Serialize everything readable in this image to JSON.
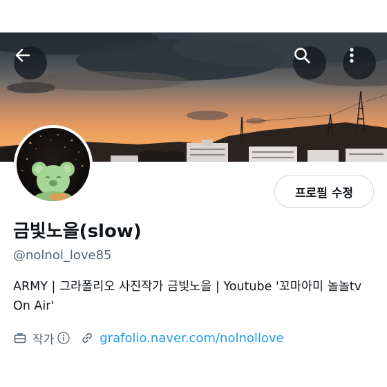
{
  "header": {
    "back_icon": "arrow-left-icon",
    "search_icon": "search-icon",
    "more_icon": "more-vertical-icon"
  },
  "profile": {
    "edit_button_label": "프로필 수정",
    "display_name": "금빛노을(slow)",
    "handle": "@nolnol_love85",
    "bio": "ARMY | 그라폴리오 사진작가 금빛노을 | Youtube '꼬마아미 놀놀tv On Air'",
    "category_label": "작가",
    "website": "grafolio.naver.com/nolnollove"
  },
  "colors": {
    "link": "#1d9bf0",
    "secondary_text": "#536471",
    "primary_text": "#0f1419",
    "border": "#cfd9de"
  }
}
